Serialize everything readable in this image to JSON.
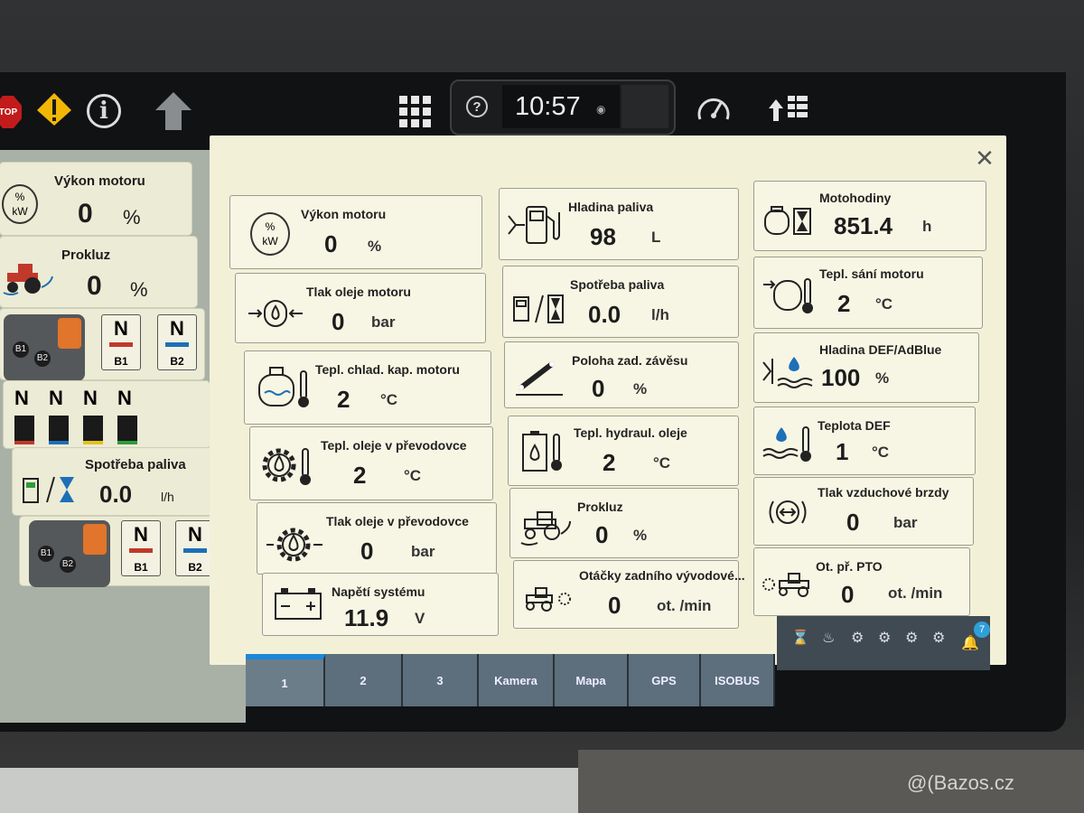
{
  "topbar": {
    "stop_label": "TOP",
    "clock": "10:57",
    "help_symbol": "?",
    "icons": [
      "stop-icon",
      "warning-icon",
      "info-icon",
      "up-arrow-icon",
      "app-grid-icon",
      "gauge-icon",
      "arrow-list-icon"
    ]
  },
  "left_panel": {
    "engine": {
      "title": "Výkon motoru",
      "value": "0",
      "unit": "%",
      "icon_text_top": "%",
      "icon_text_bottom": "kW"
    },
    "slip": {
      "title": "Prokluz",
      "value": "0",
      "unit": "%"
    },
    "valves1": [
      {
        "state": "N",
        "label": "B1"
      },
      {
        "state": "N",
        "label": "B2"
      }
    ],
    "remotes": [
      "N",
      "N",
      "N",
      "N"
    ],
    "fuel": {
      "title": "Spotřeba paliva",
      "value": "0.0",
      "unit": "l/h"
    },
    "valves2": [
      {
        "state": "N",
        "label": "B1"
      },
      {
        "state": "N",
        "label": "B2"
      }
    ],
    "ctrl_labels": [
      "B1",
      "B2"
    ]
  },
  "main": {
    "col1": [
      {
        "title": "Výkon motoru",
        "value": "0",
        "unit": "%"
      },
      {
        "title": "Tlak oleje motoru",
        "value": "0",
        "unit": "bar"
      },
      {
        "title": "Tepl. chlad. kap. motoru",
        "value": "2",
        "unit": "°C"
      },
      {
        "title": "Tepl. oleje v převodovce",
        "value": "2",
        "unit": "°C"
      },
      {
        "title": "Tlak oleje v převodovce",
        "value": "0",
        "unit": "bar"
      },
      {
        "title": "Napětí systému",
        "value": "11.9",
        "unit": "V"
      }
    ],
    "col2": [
      {
        "title": "Hladina paliva",
        "value": "98",
        "unit": "L"
      },
      {
        "title": "Spotřeba paliva",
        "value": "0.0",
        "unit": "l/h"
      },
      {
        "title": "Poloha zad. závěsu",
        "value": "0",
        "unit": "%"
      },
      {
        "title": "Tepl. hydraul. oleje",
        "value": "2",
        "unit": "°C"
      },
      {
        "title": "Prokluz",
        "value": "0",
        "unit": "%"
      },
      {
        "title": "Otáčky zadního vývodové...",
        "value": "0",
        "unit": "ot. /min"
      }
    ],
    "col3": [
      {
        "title": "Motohodiny",
        "value": "851.4",
        "unit": "h"
      },
      {
        "title": "Tepl. sání motoru",
        "value": "2",
        "unit": "°C"
      },
      {
        "title": "Hladina DEF/AdBlue",
        "value": "100",
        "unit": "%"
      },
      {
        "title": "Teplota DEF",
        "value": "1",
        "unit": "°C"
      },
      {
        "title": "Tlak vzduchové brzdy",
        "value": "0",
        "unit": "bar"
      },
      {
        "title": "Ot. př. PTO",
        "value": "0",
        "unit": "ot. /min"
      }
    ]
  },
  "tabs": [
    {
      "label": "1",
      "active": true
    },
    {
      "label": "2"
    },
    {
      "label": "3"
    },
    {
      "label": "Kamera"
    },
    {
      "label": "Mapa"
    },
    {
      "label": "GPS"
    },
    {
      "label": "ISOBUS"
    }
  ],
  "status": {
    "notification_count": "7"
  },
  "watermark": "@(Bazos.cz"
}
